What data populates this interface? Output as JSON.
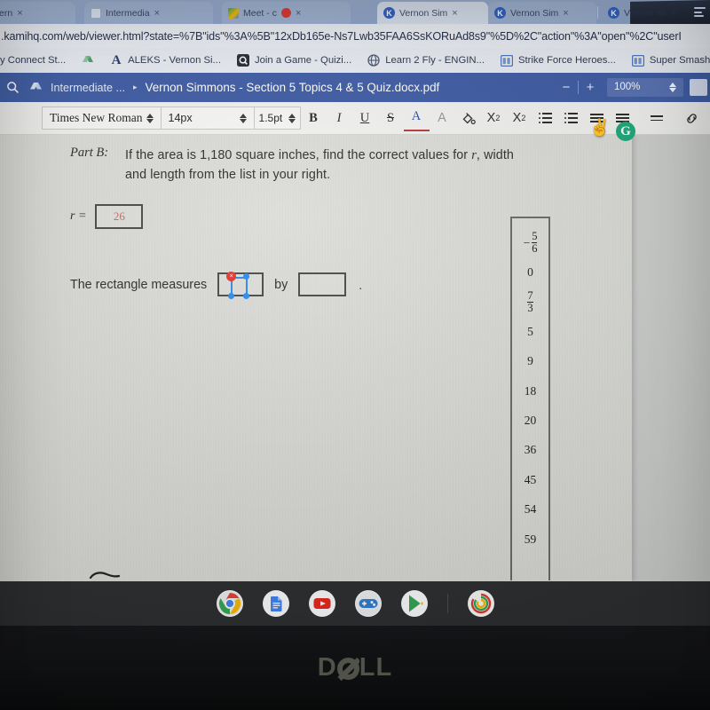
{
  "browser": {
    "tabs": [
      {
        "title": "Mail - Vern",
        "favicon": "mail-icon",
        "active": false
      },
      {
        "title": "Intermedia",
        "favicon": "drive-icon",
        "active": false
      },
      {
        "title": "Meet - c",
        "favicon": "meet-icon",
        "active": false
      },
      {
        "title": "Vernon Sim",
        "favicon": "kami-icon",
        "active": true
      },
      {
        "title": "Vernon Sim",
        "favicon": "kami-icon",
        "active": false
      },
      {
        "title": "Vernon Sim",
        "favicon": "kami-icon",
        "active": false
      }
    ],
    "tab_close_label": "×",
    "menu_icon": "hamburger-menu-icon",
    "url": ".kamihq.com/web/viewer.html?state=%7B\"ids\"%3A%5B\"12xDb165e-Ns7Lwb35FAA6SsKORuAd8s9\"%5D%2C\"action\"%3A\"open\"%2C\"userI",
    "bookmarks": [
      {
        "label": "y Connect St...",
        "icon": "generic-bookmark-icon"
      },
      {
        "label": "",
        "icon": "drive-icon"
      },
      {
        "label": "ALEKS - Vernon Si...",
        "icon": "aleks-a-icon"
      },
      {
        "label": "Join a Game - Quizi...",
        "icon": "quizizz-icon"
      },
      {
        "label": "Learn 2 Fly - ENGIN...",
        "icon": "globe-icon"
      },
      {
        "label": "Strike Force Heroes...",
        "icon": "window-icon"
      },
      {
        "label": "Super Smash Fla",
        "icon": "window-icon"
      }
    ]
  },
  "kami": {
    "search_icon": "search-icon",
    "drive_icon": "drive-icon",
    "breadcrumb_folder": "Intermediate ...",
    "breadcrumb_caret": "▸",
    "document_title": "Vernon Simmons - Section 5 Topics 4 & 5 Quiz.docx.pdf",
    "zoom_out_label": "−",
    "zoom_in_label": "+",
    "zoom_value": "100%",
    "zoom_stepper_icon": "stepper-icon",
    "panel_icon": "side-panel-icon"
  },
  "format_toolbar": {
    "font_family": "Times New Roman",
    "font_size": "14px",
    "line_spacing": "1.5pt",
    "bold_label": "B",
    "italic_label": "I",
    "underline_label": "U",
    "strikethrough_label": "S",
    "text_color_label": "A",
    "highlight_label": "A",
    "fill_icon": "paint-bucket-icon",
    "subscript_label": "X",
    "subscript_index": "2",
    "superscript_label": "X",
    "superscript_index": "2",
    "numbered_list_icon": "numbered-list-icon",
    "bulleted_list_icon": "bulleted-list-icon",
    "indent_decrease_icon": "indent-decrease-icon",
    "indent_increase_icon": "indent-increase-icon",
    "align_icon": "align-icon",
    "link_icon": "link-icon",
    "cursor_emoji": "✌️",
    "cursor_name": "hand-peace-emoji-cursor",
    "grammarly_label": "G",
    "grammarly_name": "grammarly-badge-icon"
  },
  "document": {
    "part_label": "Part B:",
    "question_line1_a": "If the area is 1,180 square inches, find the correct values for ",
    "question_var": "r",
    "question_line1_b": ", width",
    "question_line2": "and length from the list in your right.",
    "r_label": "r =",
    "r_value": "26",
    "r_value_color": "#d9625f",
    "measure_text": "The rectangle measures",
    "measure_by": "by",
    "measure_period": ".",
    "first_box_value": "",
    "second_box_value": "",
    "annotation_delete_label": "×",
    "annotation_name": "selected-annotation-widget"
  },
  "number_list": {
    "panel_name": "answer-choices-panel",
    "items": [
      {
        "type": "fraction",
        "sign": "−",
        "numerator": "5",
        "denominator": "6",
        "display": "-5/6"
      },
      {
        "type": "integer",
        "display": "0"
      },
      {
        "type": "fraction",
        "sign": "",
        "numerator": "7",
        "denominator": "3",
        "display": "7/3"
      },
      {
        "type": "integer",
        "display": "5"
      },
      {
        "type": "integer",
        "display": "9"
      },
      {
        "type": "integer",
        "display": "18"
      },
      {
        "type": "integer",
        "display": "20"
      },
      {
        "type": "integer",
        "display": "36"
      },
      {
        "type": "integer",
        "display": "45"
      },
      {
        "type": "integer",
        "display": "54"
      },
      {
        "type": "integer",
        "display": "59"
      }
    ]
  },
  "shelf": {
    "apps": [
      {
        "name": "chrome-icon",
        "label": "Chrome",
        "running": true
      },
      {
        "name": "google-docs-icon",
        "label": "Docs",
        "running": false
      },
      {
        "name": "youtube-icon",
        "label": "YouTube",
        "running": false
      },
      {
        "name": "game-controller-icon",
        "label": "Games",
        "running": false
      },
      {
        "name": "play-store-icon",
        "label": "Play Store",
        "running": false
      },
      {
        "name": "fitness-rings-icon",
        "label": "Fitness",
        "running": true
      }
    ]
  },
  "device": {
    "brand": "DELL",
    "brand_part1": "D",
    "brand_part2": "LL"
  }
}
